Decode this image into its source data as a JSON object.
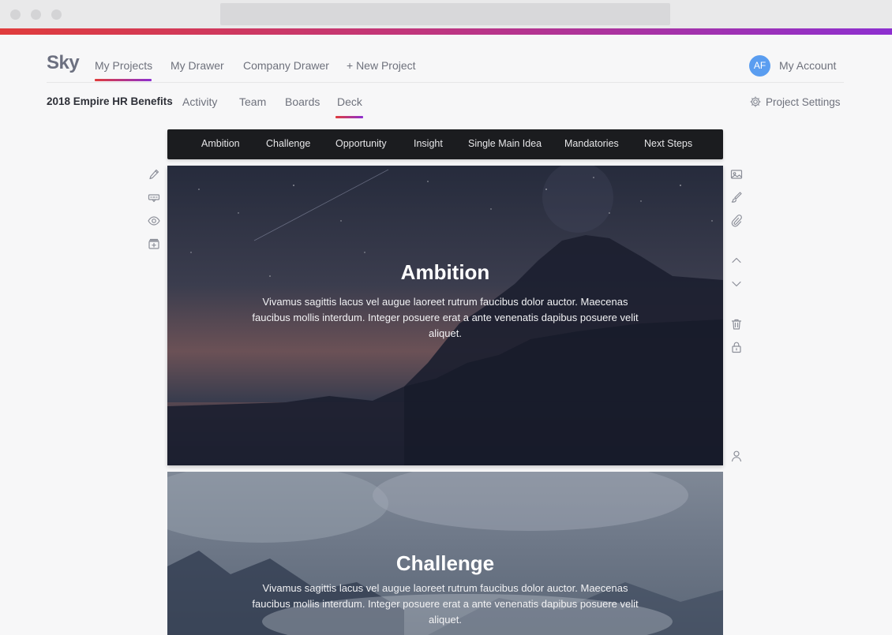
{
  "app": {
    "logo": "Sky"
  },
  "topnav": {
    "items": [
      "My Projects",
      "My Drawer",
      "Company Drawer",
      "+ New Project"
    ],
    "active": "My Projects",
    "account": {
      "initials": "AF",
      "label": "My Account"
    }
  },
  "project": {
    "title": "2018 Empire HR Benefits",
    "tabs": [
      "Activity",
      "Team",
      "Boards",
      "Deck"
    ],
    "active_tab": "Deck",
    "settings_label": "Project Settings"
  },
  "deck": {
    "sections": [
      "Ambition",
      "Challenge",
      "Opportunity",
      "Insight",
      "Single Main Idea",
      "Mandatories",
      "Next Steps"
    ],
    "slides": [
      {
        "title": "Ambition",
        "body": "Vivamus sagittis lacus vel augue laoreet rutrum faucibus dolor auctor. Maecenas faucibus mollis interdum. Integer posuere erat a ante venenatis dapibus posuere velit aliquet."
      },
      {
        "title": "Challenge",
        "body": "Vivamus sagittis lacus vel augue laoreet rutrum faucibus dolor auctor. Maecenas faucibus mollis interdum. Integer posuere erat a ante venenatis dapibus posuere velit aliquet."
      }
    ]
  },
  "icons": {
    "left_tools": [
      "pencil-icon",
      "caption-icon",
      "eye-icon",
      "archive-add-icon"
    ],
    "right_tools": [
      "image-icon",
      "brush-icon",
      "paperclip-icon",
      "chevron-up-icon",
      "chevron-down-icon",
      "trash-icon",
      "lock-icon",
      "user-icon"
    ]
  },
  "colors": {
    "accent_start": "#e03c3c",
    "accent_end": "#8d2fd0",
    "avatar": "#5a9df0",
    "section_bar": "#1b1c1f"
  }
}
